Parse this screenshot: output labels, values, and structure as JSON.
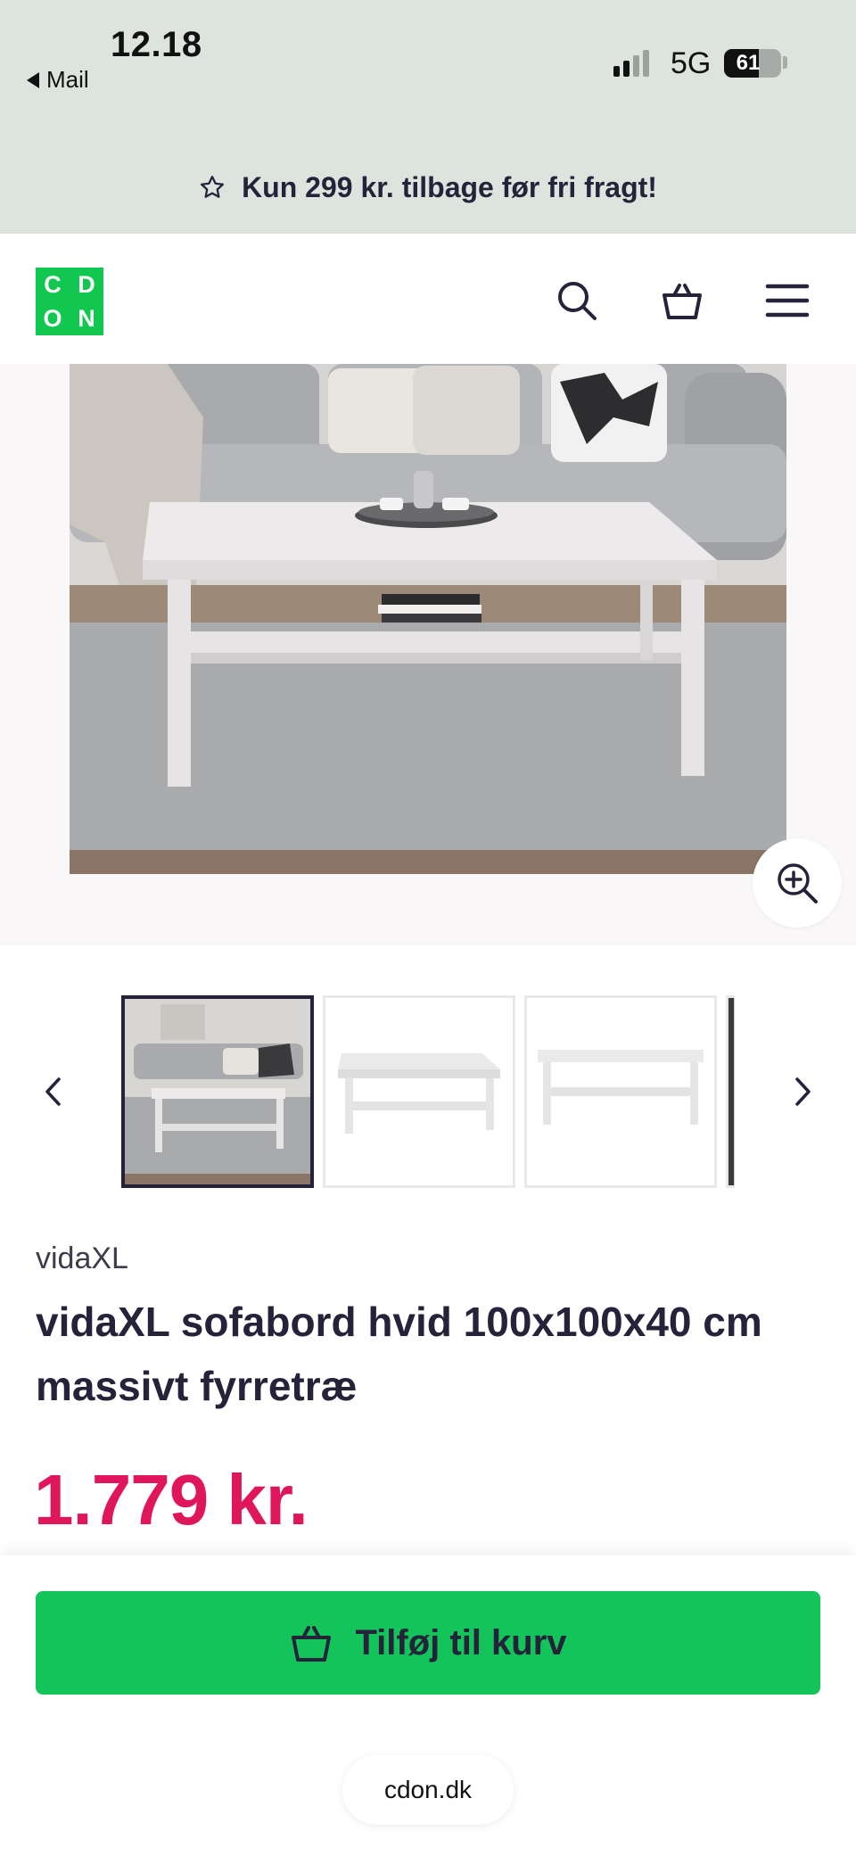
{
  "status_bar": {
    "time": "12.18",
    "back_app": "Mail",
    "network": "5G",
    "battery": "61"
  },
  "promo": {
    "icon": "star-outline-icon",
    "text": "Kun 299 kr. tilbage før fri fragt!"
  },
  "header": {
    "logo_letters": [
      "C",
      "D",
      "O",
      "N"
    ],
    "logo_color": "#12c74f",
    "icons": [
      "search-icon",
      "basket-icon",
      "menu-icon"
    ]
  },
  "gallery": {
    "thumbnail_count_visible": 4,
    "active_thumbnail": 1
  },
  "product": {
    "brand": "vidaXL",
    "title": "vidaXL sofabord hvid 100x100x40 cm massivt fyrretræ",
    "price": "1.779 kr.",
    "price_color": "#e0165c"
  },
  "cta": {
    "label": "Tilføj til kurv",
    "icon": "basket-icon",
    "color": "#12c45a"
  },
  "browser": {
    "url": "cdon.dk"
  }
}
